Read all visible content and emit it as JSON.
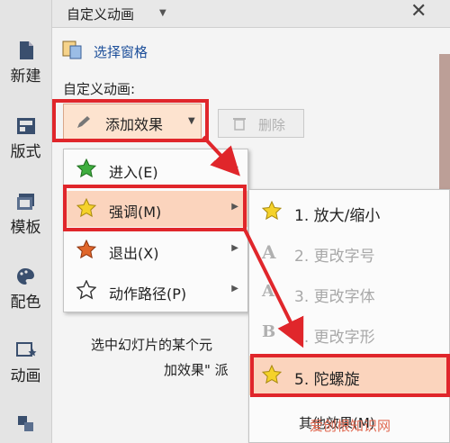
{
  "left_nav": [
    {
      "label": "新建",
      "icon": "new-doc-icon"
    },
    {
      "label": "版式",
      "icon": "layout-icon"
    },
    {
      "label": "模板",
      "icon": "template-icon"
    },
    {
      "label": "配色",
      "icon": "palette-icon"
    },
    {
      "label": "动画",
      "icon": "animation-icon"
    }
  ],
  "panel": {
    "title": "自定义动画",
    "select_pane": "选择窗格",
    "section_label": "自定义动画:",
    "add_effect": "添加效果",
    "delete": "删除",
    "hint_line1": "选中幻灯片的某个元",
    "hint_line2": "加效果\" 派"
  },
  "effect_menu": [
    {
      "label": "进入(E)",
      "icon": "green-star-icon"
    },
    {
      "label": "强调(M)",
      "icon": "yellow-star-icon",
      "highlighted": true
    },
    {
      "label": "退出(X)",
      "icon": "red-star-icon"
    },
    {
      "label": "动作路径(P)",
      "icon": "outline-star-icon"
    }
  ],
  "emphasis_submenu": [
    {
      "label": "1. 放大/缩小",
      "icon": "grow-star-icon",
      "disabled": false
    },
    {
      "label": "2. 更改字号",
      "icon": "font-size-icon",
      "disabled": true
    },
    {
      "label": "3. 更改字体",
      "icon": "font-face-icon",
      "disabled": true
    },
    {
      "label": "4. 更改字形",
      "icon": "font-style-icon",
      "disabled": true
    },
    {
      "label": "5. 陀螺旋",
      "icon": "spin-star-icon",
      "disabled": false,
      "highlighted": true
    },
    {
      "label": "其他效果(M)",
      "icon": "",
      "disabled": false
    }
  ],
  "watermark": "爱创根知识网",
  "colors": {
    "highlight_box": "#e0262b",
    "menu_highlight": "#fbd4bd",
    "link_blue": "#1d4f9a"
  }
}
